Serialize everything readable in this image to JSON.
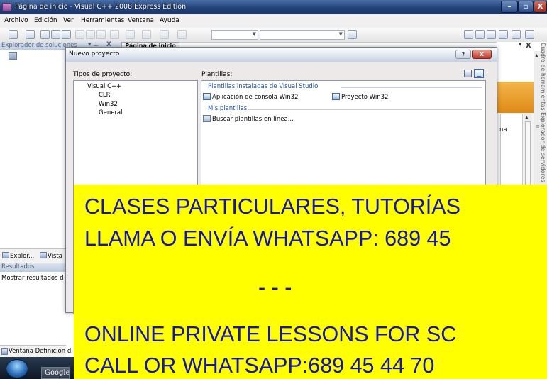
{
  "window": {
    "title": "Página de inicio - Visual C++ 2008 Express Edition",
    "buttons": {
      "minimize": "–",
      "maximize": "▫",
      "close": "X"
    }
  },
  "menubar": [
    "Archivo",
    "Edición",
    "Ver",
    "Herramientas",
    "Ventana",
    "Ayuda"
  ],
  "solution_explorer": {
    "title": "Explorador de soluciones",
    "pin": "▾ ⊥",
    "close": "X",
    "start_tab": "Página de inicio"
  },
  "left_tabs": [
    "Explor...",
    "Vista"
  ],
  "results": {
    "title": "Resultados",
    "show": "Mostrar resultados d"
  },
  "left_bottom_tab": "Ventana Definición d",
  "dialog": {
    "title": "Nuevo proyecto",
    "help": "?",
    "close": "X",
    "project_types_label": "Tipos de proyecto:",
    "templates_label": "Plantillas:",
    "tree": {
      "root": "Visual C++",
      "children": [
        "CLR",
        "Win32",
        "General"
      ]
    },
    "groups": {
      "installed": "Plantillas instaladas de Visual Studio",
      "mine": "Mis plantillas"
    },
    "templates": [
      "Aplicación de consola Win32",
      "Proyecto Win32"
    ],
    "search_online": "Buscar plantillas en línea..."
  },
  "start_page": {
    "fragment": "na",
    "vertical_text": "Cuadro de herramientas  Explorador de servidores",
    "close": "X",
    "pin": "▾"
  },
  "taskbar": {
    "pinned_app": "Google"
  },
  "banner": {
    "line1": "CLASES PARTICULARES, TUTORÍAS",
    "line2": "LLAMA O ENVÍA WHATSAPP: 689 45",
    "line3": "- - -",
    "line4": "ONLINE PRIVATE LESSONS FOR SC",
    "line5": "CALL OR WHATSAPP:689 45 44 70"
  },
  "colors": {
    "titlebar": "#24427a",
    "banner_bg": "#ffff00",
    "banner_text": "#1515b0",
    "group_header": "#1d4fa0"
  }
}
